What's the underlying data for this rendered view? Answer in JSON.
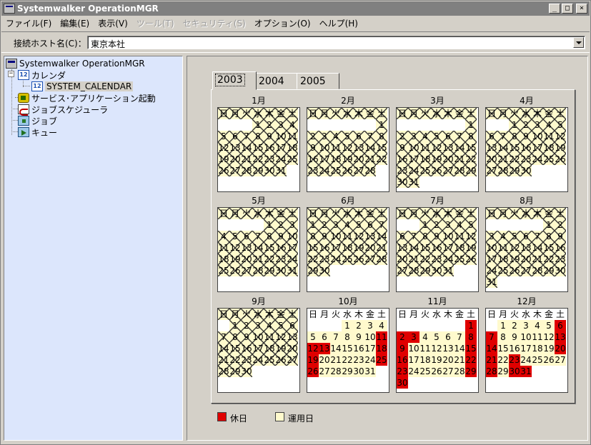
{
  "window": {
    "title": "Systemwalker OperationMGR",
    "minimize": "_",
    "maximize": "□",
    "close": "×"
  },
  "menu": [
    {
      "label": "ファイル(F)",
      "enabled": true
    },
    {
      "label": "編集(E)",
      "enabled": true
    },
    {
      "label": "表示(V)",
      "enabled": true
    },
    {
      "label": "ツール(T)",
      "enabled": false
    },
    {
      "label": "セキュリティ(S)",
      "enabled": false
    },
    {
      "label": "オプション(O)",
      "enabled": true
    },
    {
      "label": "ヘルプ(H)",
      "enabled": true
    }
  ],
  "host": {
    "label": "接続ホスト名(C)：",
    "value": "東京本社"
  },
  "tree": {
    "root": "Systemwalker OperationMGR",
    "calendar": "カレンダ",
    "system_calendar": "SYSTEM_CALENDAR",
    "service": "サービス･アプリケーション起動",
    "scheduler": "ジョブスケジューラ",
    "job": "ジョブ",
    "queue": "キュー",
    "calendar_icon_text": "12"
  },
  "tabs": [
    "2003",
    "2004",
    "2005"
  ],
  "active_tab": "2003",
  "weekdays": [
    "日",
    "月",
    "火",
    "水",
    "木",
    "金",
    "土"
  ],
  "months": [
    {
      "title": "1月",
      "first_dow": 3,
      "days": 31,
      "holidays": []
    },
    {
      "title": "2月",
      "first_dow": 6,
      "days": 28,
      "holidays": []
    },
    {
      "title": "3月",
      "first_dow": 6,
      "days": 31,
      "holidays": []
    },
    {
      "title": "4月",
      "first_dow": 2,
      "days": 30,
      "holidays": []
    },
    {
      "title": "5月",
      "first_dow": 4,
      "days": 31,
      "holidays": []
    },
    {
      "title": "6月",
      "first_dow": 0,
      "days": 30,
      "holidays": []
    },
    {
      "title": "7月",
      "first_dow": 2,
      "days": 31,
      "holidays": []
    },
    {
      "title": "8月",
      "first_dow": 5,
      "days": 31,
      "holidays": []
    },
    {
      "title": "9月",
      "first_dow": 1,
      "days": 30,
      "holidays": []
    },
    {
      "title": "10月",
      "first_dow": 3,
      "days": 31,
      "holidays": [
        11,
        12,
        13,
        18,
        19,
        25,
        26
      ]
    },
    {
      "title": "11月",
      "first_dow": 6,
      "days": 30,
      "holidays": [
        1,
        2,
        3,
        8,
        9,
        15,
        16,
        22,
        23,
        29,
        30
      ]
    },
    {
      "title": "12月",
      "first_dow": 1,
      "days": 31,
      "holidays": [
        6,
        7,
        13,
        14,
        20,
        21,
        23,
        28,
        30,
        31
      ]
    }
  ],
  "past_month_count": 9,
  "past_month_count_note": "Months 1-9 are shown with crossed-out (past) date cells",
  "legend": {
    "holiday": "休日",
    "workday": "運用日"
  },
  "colors": {
    "holiday": "#e00000",
    "workday": "#fffacd",
    "tree_bg": "#dce6fc",
    "titlebar": "#808080"
  }
}
